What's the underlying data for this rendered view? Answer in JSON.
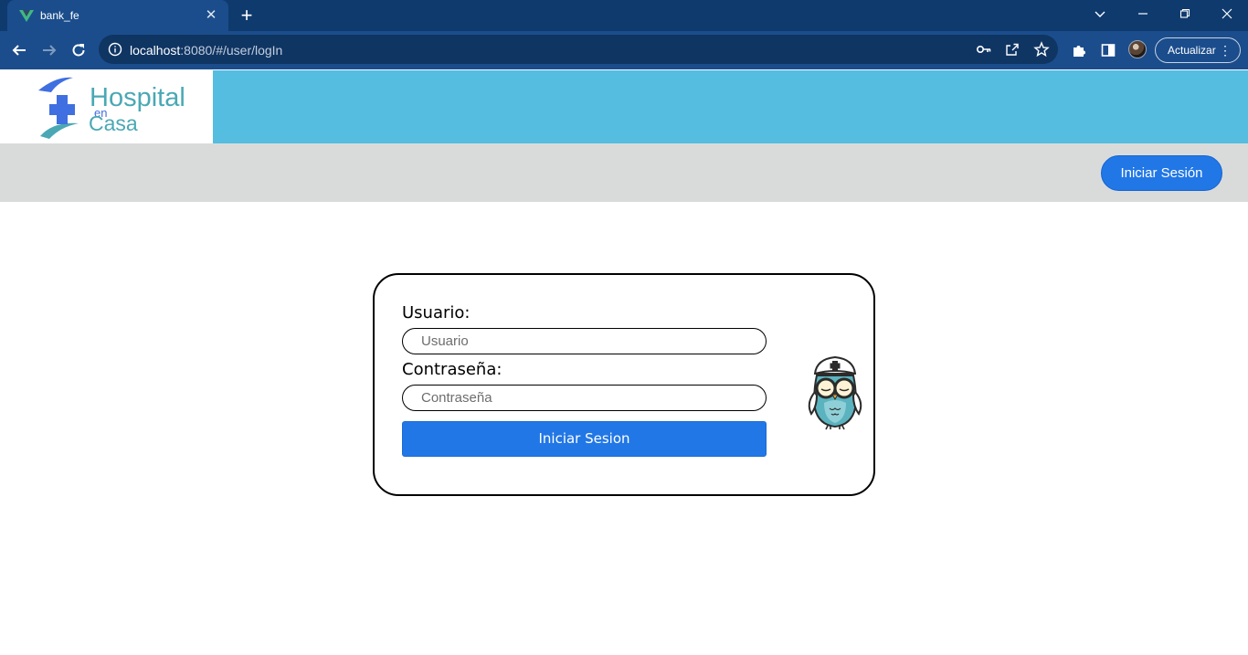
{
  "browser": {
    "tab_title": "bank_fe",
    "tab_close": "✕",
    "new_tab": "+",
    "url_host": "localhost",
    "url_rest": ":8080/#/user/logIn",
    "update_label": "Actualizar",
    "update_menu": "⋮"
  },
  "brand": {
    "logo_line1": "Hospital",
    "logo_line2": "en",
    "logo_line3": "Casa",
    "header_color": "#55bde0",
    "accent_color": "#2177e6"
  },
  "nav": {
    "login_button": "Iniciar Sesión"
  },
  "login": {
    "user_label": "Usuario:",
    "user_placeholder": "Usuario",
    "user_value": "",
    "password_label": "Contraseña:",
    "password_placeholder": "Contraseña",
    "password_value": "",
    "submit_label": "Iniciar Sesion"
  },
  "icons": {
    "favicon": "vue-logo-icon",
    "back": "arrow-left-icon",
    "forward": "arrow-right-icon",
    "reload": "reload-icon",
    "site_info": "info-icon",
    "password_key": "key-icon",
    "share": "share-icon",
    "bookmark": "star-icon",
    "extensions": "puzzle-icon",
    "side_panel": "side-panel-icon",
    "mascot": "nurse-owl-icon"
  }
}
